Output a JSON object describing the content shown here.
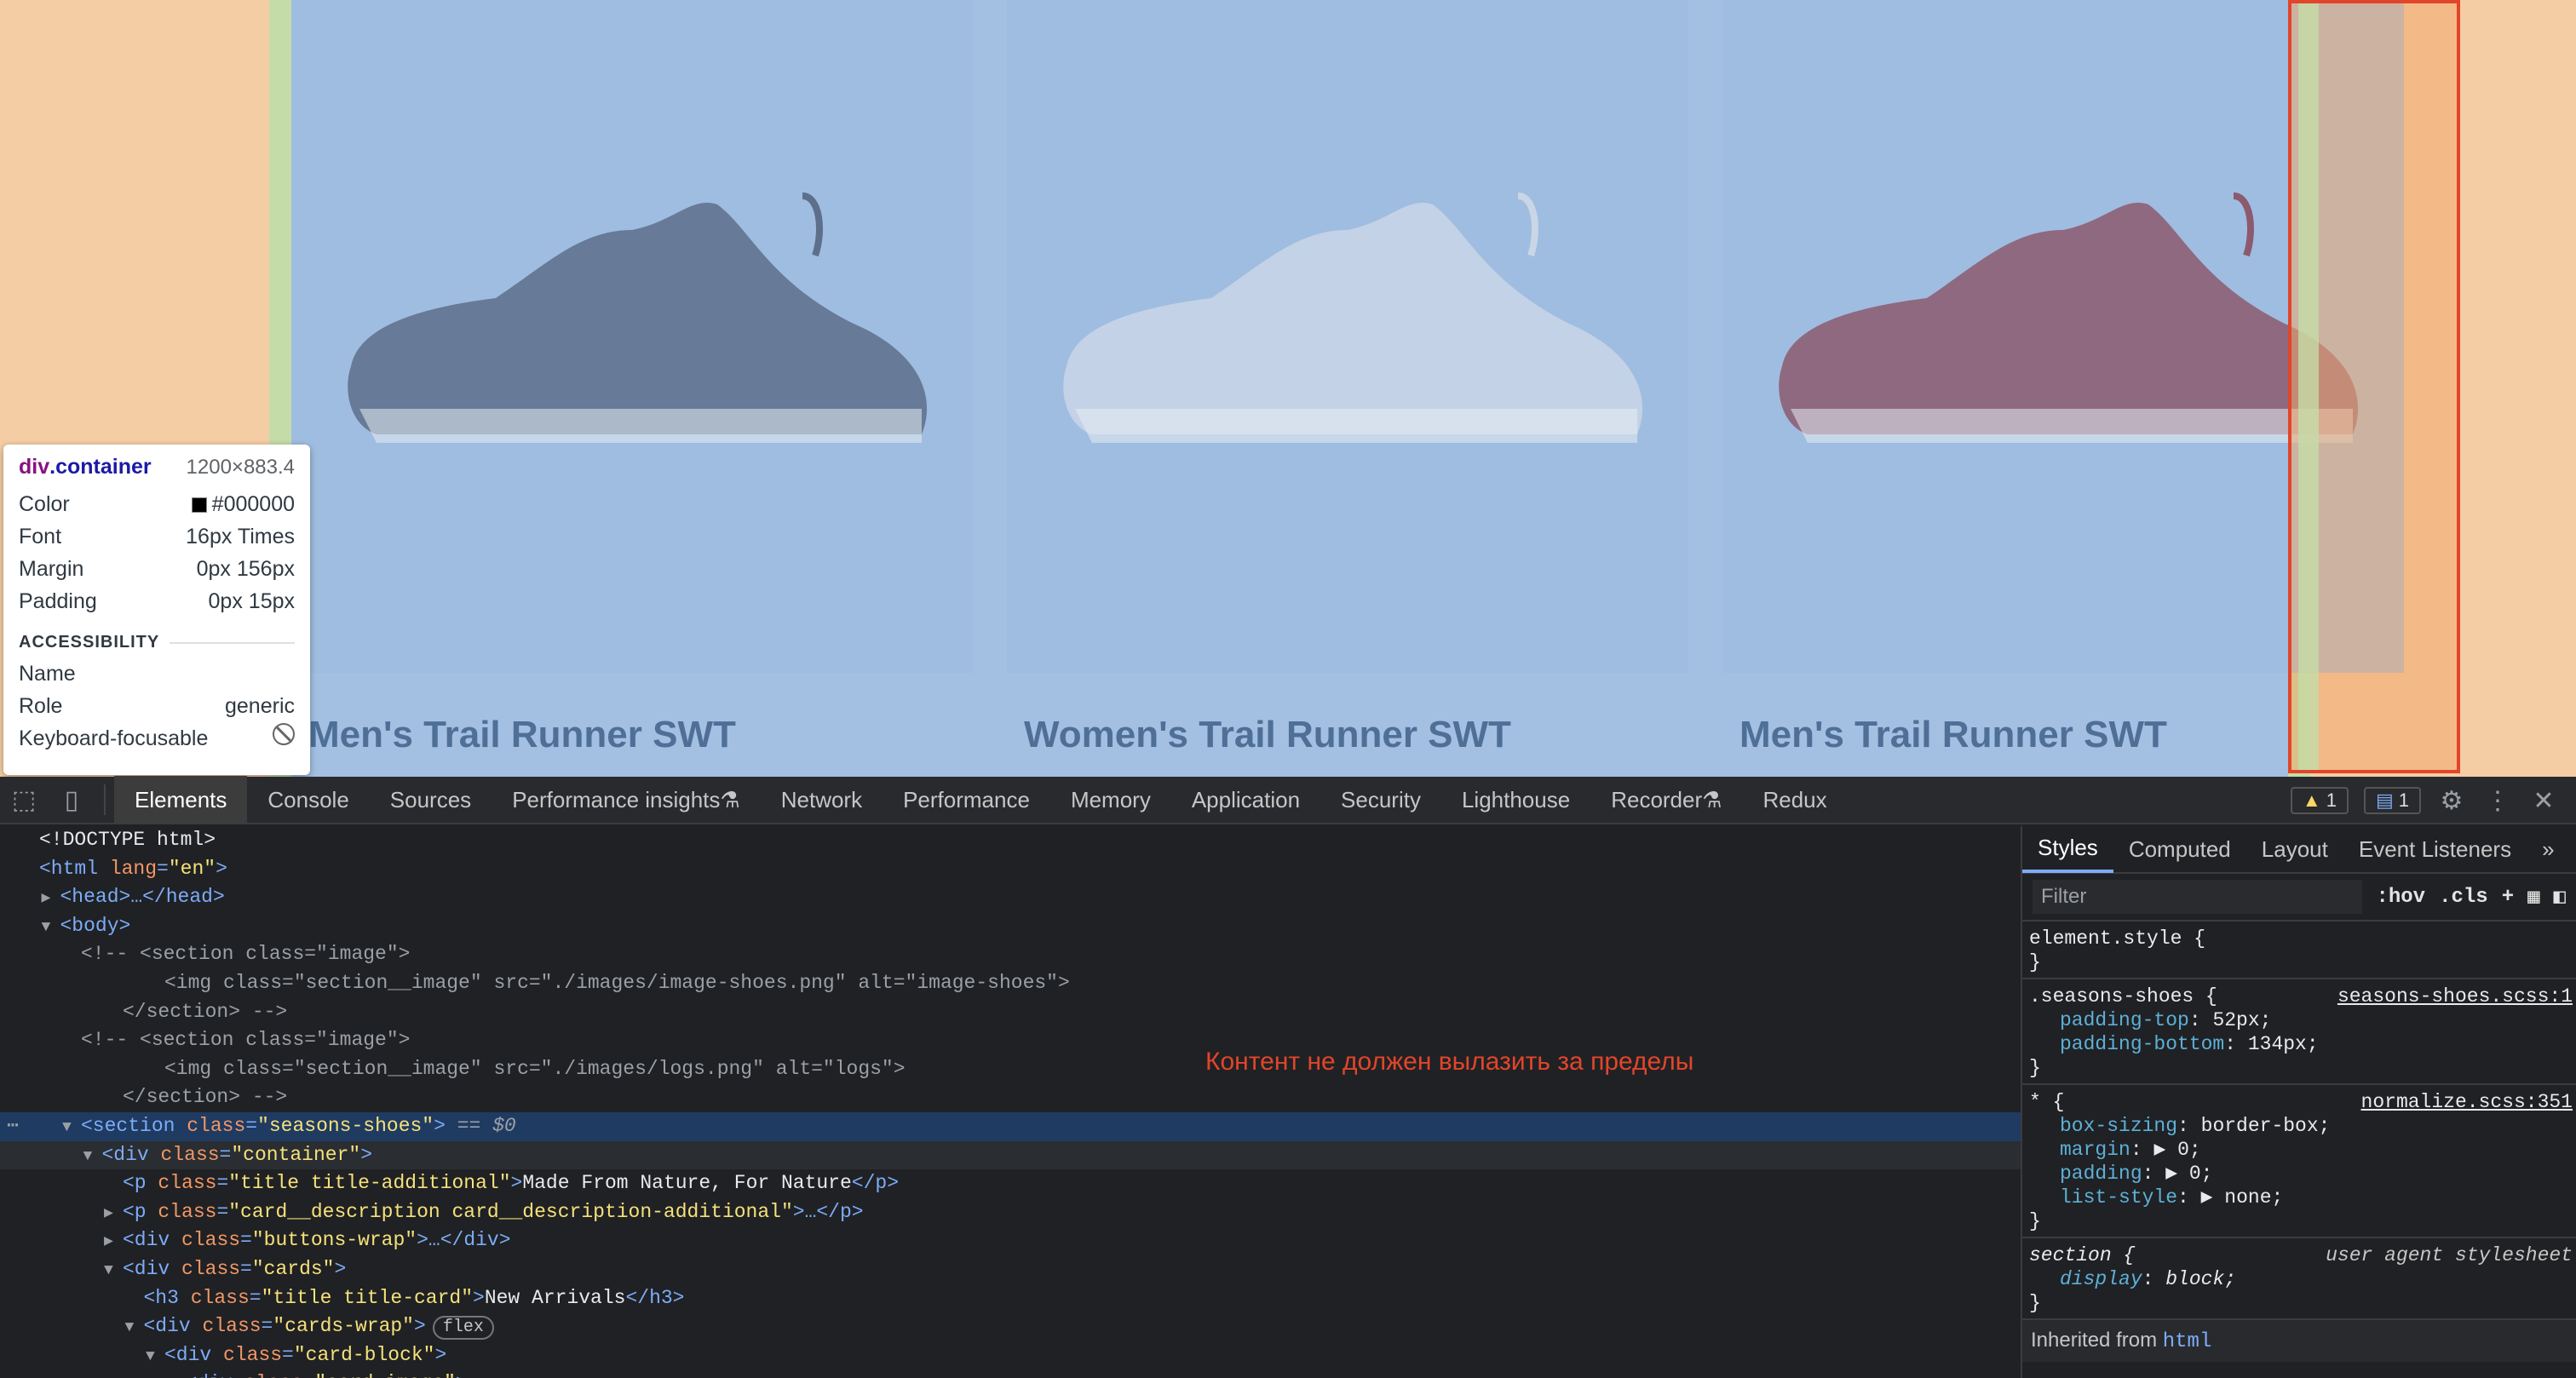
{
  "viewport": {
    "cards": [
      {
        "title": "Men's Trail Runner SWT",
        "color": "#5d6f8a"
      },
      {
        "title": "Women's Trail Runner SWT",
        "color": "#c9d6e6"
      },
      {
        "title": "Men's Trail Runner SWT",
        "color": "#8c5a6e"
      }
    ]
  },
  "tooltip": {
    "tag": "div",
    "cls": ".container",
    "size": "1200×883.4",
    "rows": [
      {
        "label": "Color",
        "value": "#000000"
      },
      {
        "label": "Font",
        "value": "16px Times"
      },
      {
        "label": "Margin",
        "value": "0px 156px"
      },
      {
        "label": "Padding",
        "value": "0px 15px"
      }
    ],
    "accessibility_title": "ACCESSIBILITY",
    "a11y": [
      {
        "label": "Name",
        "value": ""
      },
      {
        "label": "Role",
        "value": "generic"
      },
      {
        "label": "Keyboard-focusable",
        "value": ""
      }
    ]
  },
  "devtools": {
    "tabs": [
      "Elements",
      "Console",
      "Sources",
      "Performance insights",
      "Network",
      "Performance",
      "Memory",
      "Application",
      "Security",
      "Lighthouse",
      "Recorder",
      "Redux"
    ],
    "warning_count": "1",
    "message_count": "1",
    "note": "Контент не должен вылазить за пределы",
    "dom_lines": [
      {
        "i": 0,
        "tri": "",
        "html": "<!DOCTYPE html>",
        "kind": "text"
      },
      {
        "i": 0,
        "tri": "",
        "tag": "html",
        "attrs": [
          [
            "lang",
            "en"
          ]
        ],
        "close": false
      },
      {
        "i": 1,
        "tri": "▶",
        "tag": "head",
        "suffix": "…</head>"
      },
      {
        "i": 1,
        "tri": "▼",
        "tag": "body"
      },
      {
        "i": 2,
        "tri": "",
        "comment": "<!-- <section class=\"image\">"
      },
      {
        "i": 6,
        "tri": "",
        "comment": "<img class=\"section__image\" src=\"./images/image-shoes.png\" alt=\"image-shoes\">"
      },
      {
        "i": 4,
        "tri": "",
        "comment": "</section> -->"
      },
      {
        "i": 2,
        "tri": "",
        "comment": "<!-- <section class=\"image\">"
      },
      {
        "i": 6,
        "tri": "",
        "comment": "<img class=\"section__image\" src=\"./images/logs.png\" alt=\"logs\">"
      },
      {
        "i": 4,
        "tri": "",
        "comment": "</section> -->"
      },
      {
        "i": 2,
        "tri": "▼",
        "tag": "section",
        "attrs": [
          [
            "class",
            "seasons-shoes"
          ]
        ],
        "after": " == $0",
        "sel": true
      },
      {
        "i": 3,
        "tri": "▼",
        "tag": "div",
        "attrs": [
          [
            "class",
            "container"
          ]
        ],
        "hov": true
      },
      {
        "i": 4,
        "tri": "",
        "tag": "p",
        "attrs": [
          [
            "class",
            "title title-additional"
          ]
        ],
        "text": "Made From Nature, For Nature",
        "closeTag": "p"
      },
      {
        "i": 4,
        "tri": "▶",
        "tag": "p",
        "attrs": [
          [
            "class",
            "card__description card__description-additional"
          ]
        ],
        "suffix": "…</p>"
      },
      {
        "i": 4,
        "tri": "▶",
        "tag": "div",
        "attrs": [
          [
            "class",
            "buttons-wrap"
          ]
        ],
        "suffix": "…</div>"
      },
      {
        "i": 4,
        "tri": "▼",
        "tag": "div",
        "attrs": [
          [
            "class",
            "cards"
          ]
        ]
      },
      {
        "i": 5,
        "tri": "",
        "tag": "h3",
        "attrs": [
          [
            "class",
            "title title-card"
          ]
        ],
        "text": "New Arrivals",
        "closeTag": "h3"
      },
      {
        "i": 5,
        "tri": "▼",
        "tag": "div",
        "attrs": [
          [
            "class",
            "cards-wrap"
          ]
        ],
        "badge": "flex"
      },
      {
        "i": 6,
        "tri": "▼",
        "tag": "div",
        "attrs": [
          [
            "class",
            "card-block"
          ]
        ]
      },
      {
        "i": 7,
        "tri": "▼",
        "tag": "div",
        "attrs": [
          [
            "class",
            "card-image"
          ]
        ]
      }
    ],
    "styles": {
      "tabs": [
        "Styles",
        "Computed",
        "Layout",
        "Event Listeners"
      ],
      "filter_placeholder": "Filter",
      "hov": ":hov",
      "cls": ".cls",
      "rules": [
        {
          "selector": "element.style {",
          "source": "",
          "props": [],
          "close": "}"
        },
        {
          "selector": ".seasons-shoes {",
          "source": "seasons-shoes.scss:1",
          "props": [
            [
              "padding-top",
              "52px;"
            ],
            [
              "padding-bottom",
              "134px;"
            ]
          ],
          "close": "}"
        },
        {
          "selector": "* {",
          "source": "normalize.scss:351",
          "props": [
            [
              "box-sizing",
              "border-box;"
            ],
            [
              "margin",
              "▶ 0;"
            ],
            [
              "padding",
              "▶ 0;"
            ],
            [
              "list-style",
              "▶ none;"
            ]
          ],
          "close": "}"
        },
        {
          "selector": "section {",
          "source": "user agent stylesheet",
          "ua": true,
          "props": [
            [
              "display",
              "block;"
            ]
          ],
          "close": "}"
        }
      ],
      "inherited_label": "Inherited from",
      "inherited_tag": "html"
    }
  }
}
